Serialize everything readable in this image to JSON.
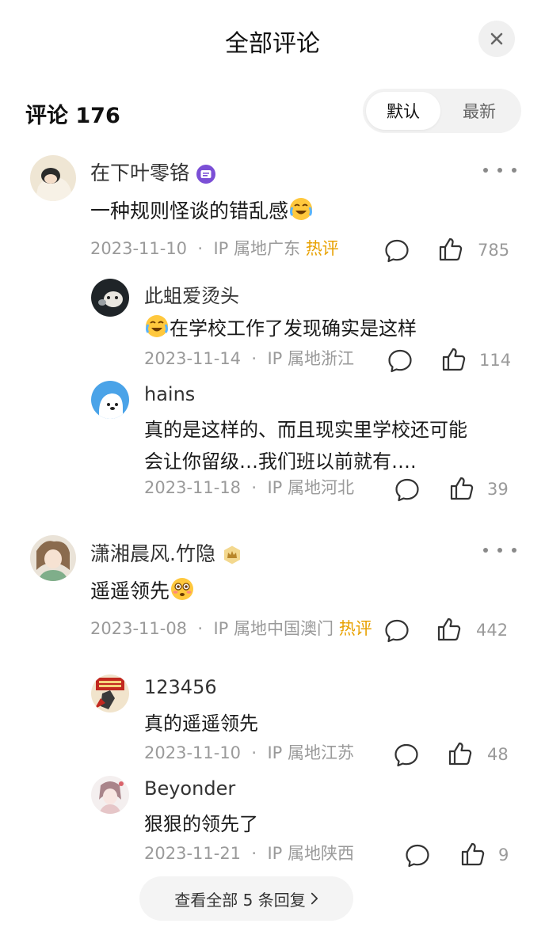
{
  "header": {
    "title": "全部评论",
    "close_icon": "close-icon"
  },
  "comments_header": {
    "count_label": "评论 176",
    "sort_options": [
      "默认",
      "最新"
    ],
    "active_sort": "默认"
  },
  "comments": [
    {
      "user": "在下叶零铬",
      "badge": "message-badge-icon",
      "text": "一种规则怪谈的错乱感",
      "emoji": "crying-laughing-emoji",
      "date": "2023-11-10",
      "location": "IP 属地广东",
      "tag": "热评",
      "likes": "785",
      "replies": [
        {
          "user": "此蛆爱烫头",
          "emoji": "crying-laughing-emoji",
          "text": "在学校工作了发现确实是这样",
          "date": "2023-11-14",
          "location": "IP 属地浙江",
          "likes": "114"
        },
        {
          "user": "hains",
          "text_line1": "真的是这样的、而且现实里学校还可能",
          "text_line2": "会让你留级…我们班以前就有….",
          "date": "2023-11-18",
          "location": "IP 属地河北",
          "likes": "39"
        }
      ]
    },
    {
      "user": "潇湘晨风.竹隐",
      "badge": "crown-badge-icon",
      "text": "遥遥领先",
      "emoji": "flushed-emoji",
      "date": "2023-11-08",
      "location": "IP 属地中国澳门",
      "tag": "热评",
      "likes": "442",
      "replies": [
        {
          "user": "123456",
          "text": "真的遥遥领先",
          "date": "2023-11-10",
          "location": "IP 属地江苏",
          "likes": "48"
        },
        {
          "user": "Beyonder",
          "text": "狠狠的领先了",
          "date": "2023-11-21",
          "location": "IP 属地陕西",
          "likes": "9"
        }
      ],
      "view_all_label": "查看全部 5 条回复"
    }
  ],
  "separator": "·",
  "colors": {
    "hot": "#e8a100",
    "meta": "#9a9a9a",
    "pill_bg": "#f2f2f2"
  }
}
